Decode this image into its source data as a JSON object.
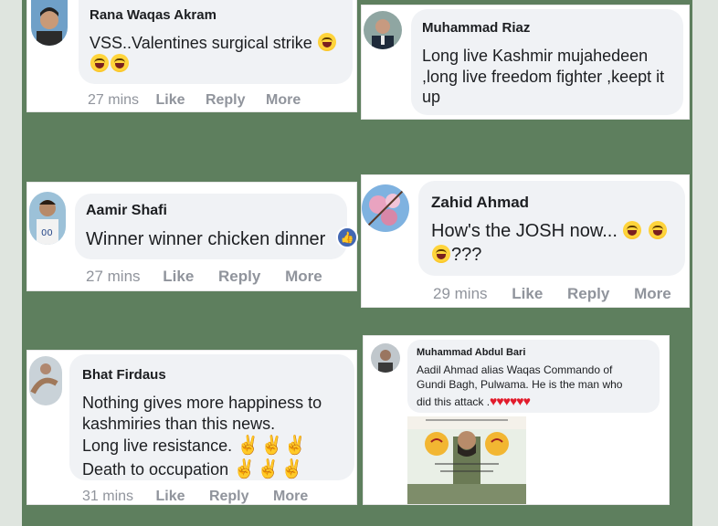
{
  "comments": [
    {
      "name": "Rana Waqas Akram",
      "text": "VSS..Valentines surgical strike",
      "emoji": "laughing-face-emoji x3",
      "time": "27 mins",
      "like": "Like",
      "reply": "Reply",
      "more": "More"
    },
    {
      "name": "Muhammad Riaz",
      "line1": "Long live Kashmir mujahedeen",
      "line2": ",long live freedom fighter ,keept it",
      "line3": "up"
    },
    {
      "name": "Aamir Shafi",
      "text": "Winner winner chicken dinner",
      "time": "27 mins",
      "like": "Like",
      "reply": "Reply",
      "more": "More"
    },
    {
      "name": "Zahid Ahmad",
      "line1": "How's the JOSH now...",
      "line2": "???",
      "time": "29 mins",
      "like": "Like",
      "reply": "Reply",
      "more": "More"
    },
    {
      "name": "Bhat Firdaus",
      "line1": "Nothing gives more happiness to",
      "line2": "kashmiries than this news.",
      "line3": "Long live resistance.",
      "line4": "Death to occupation",
      "time": "31 mins",
      "like": "Like",
      "reply": "Reply",
      "more": "More"
    },
    {
      "name": "Muhammad Abdul Bari",
      "line1": "Aadil Ahmad alias Waqas Commando of",
      "line2": "Gundi Bagh, Pulwama. He is the man who",
      "line3": "did this attack .",
      "hearts": "♥♥♥♥♥♥"
    }
  ],
  "colors": {
    "background": "#5e7f5e",
    "bubble": "#f0f2f5",
    "meta": "#90949c",
    "like_badge": "#4267b2"
  },
  "icons": [
    "laughing-face-emoji",
    "like-thumb-icon",
    "heart-emoji",
    "clapping-hands-emoji"
  ]
}
